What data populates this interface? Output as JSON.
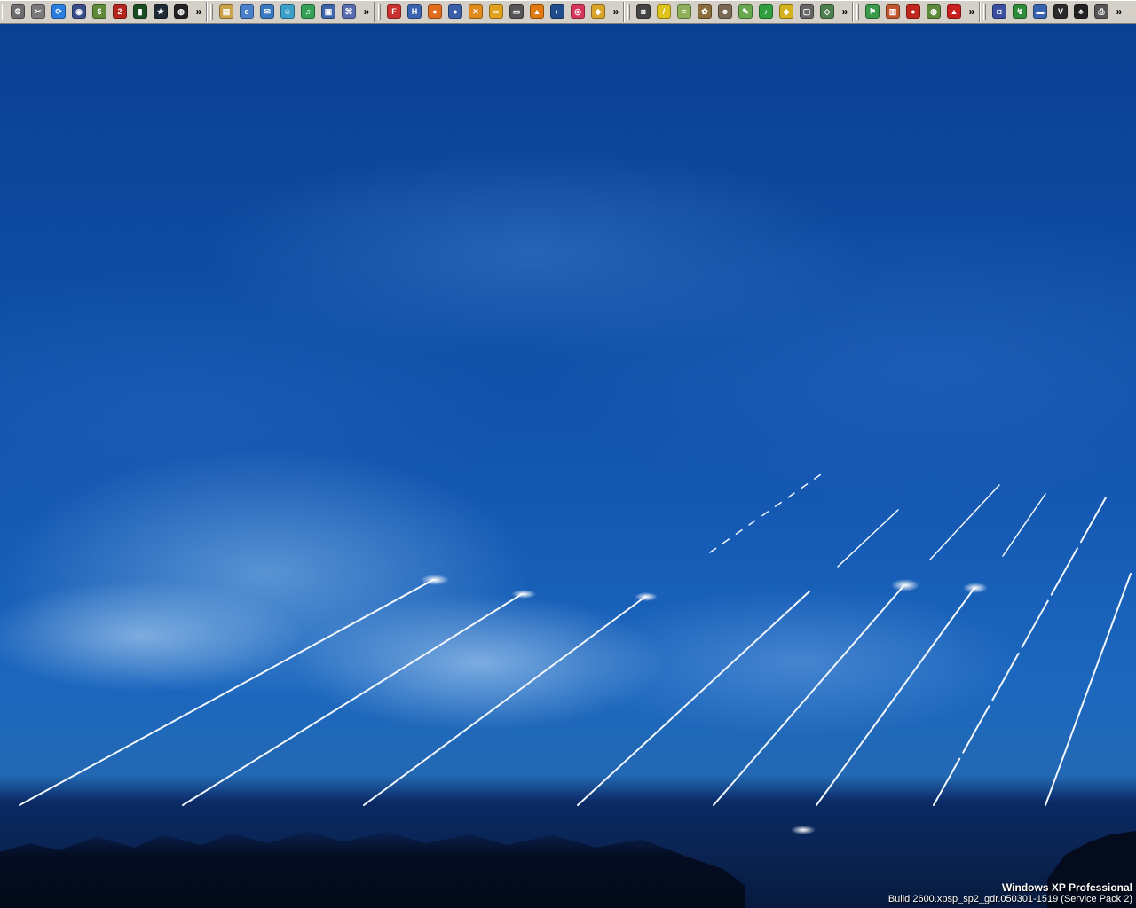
{
  "toolbar": {
    "overflow_glyph": "»",
    "groups": [
      {
        "icons": [
          {
            "name": "gear-wrench-icon",
            "glyph": "⚙",
            "color": "#6d6d6d"
          },
          {
            "name": "tools-icon",
            "glyph": "✂",
            "color": "#7a7a7a"
          },
          {
            "name": "refresh-globe-icon",
            "glyph": "⟳",
            "color": "#2b7de0"
          },
          {
            "name": "disk-manager-icon",
            "glyph": "◉",
            "color": "#3a4f8a"
          },
          {
            "name": "money-icon",
            "glyph": "$",
            "color": "#5f8a3a"
          },
          {
            "name": "two-icon",
            "glyph": "2",
            "color": "#b3261e"
          },
          {
            "name": "terminal-icon",
            "glyph": "▮",
            "color": "#1c4d22"
          },
          {
            "name": "star-app-icon",
            "glyph": "★",
            "color": "#1d2a35"
          },
          {
            "name": "steam-icon",
            "glyph": "◍",
            "color": "#222222"
          }
        ]
      },
      {
        "icons": [
          {
            "name": "folder-icon",
            "glyph": "▤",
            "color": "#c9a24a"
          },
          {
            "name": "internet-explorer-icon",
            "glyph": "e",
            "color": "#4b7fc9"
          },
          {
            "name": "outlook-icon",
            "glyph": "✉",
            "color": "#3a78c0"
          },
          {
            "name": "messenger-icon",
            "glyph": "☺",
            "color": "#3aa0c8"
          },
          {
            "name": "media-icon",
            "glyph": "♫",
            "color": "#33a055"
          },
          {
            "name": "remote-desktop-icon",
            "glyph": "▣",
            "color": "#4064a8"
          },
          {
            "name": "network-icon",
            "glyph": "⌘",
            "color": "#5a6cb0"
          }
        ]
      },
      {
        "icons": [
          {
            "name": "filezilla-icon",
            "glyph": "F",
            "color": "#c8312d"
          },
          {
            "name": "html-editor-icon",
            "glyph": "H",
            "color": "#3a64b0"
          },
          {
            "name": "firefox-icon",
            "glyph": "●",
            "color": "#e06d1c"
          },
          {
            "name": "thunderbird-icon",
            "glyph": "●",
            "color": "#3a5fa8"
          },
          {
            "name": "x-tool-icon",
            "glyph": "✕",
            "color": "#e08a1c"
          },
          {
            "name": "chat-icon",
            "glyph": "∞",
            "color": "#e0a21c"
          },
          {
            "name": "image-viewer-icon",
            "glyph": "▭",
            "color": "#555555"
          },
          {
            "name": "vlc-icon",
            "glyph": "▲",
            "color": "#e07a10"
          },
          {
            "name": "google-earth-icon",
            "glyph": "◐",
            "color": "#1f4d8c"
          },
          {
            "name": "cd-burner-icon",
            "glyph": "◎",
            "color": "#d6365a"
          },
          {
            "name": "ticket-icon",
            "glyph": "◆",
            "color": "#d9a52a"
          }
        ]
      },
      {
        "icons": [
          {
            "name": "camera-icon",
            "glyph": "◙",
            "color": "#444444"
          },
          {
            "name": "pencil-icon",
            "glyph": "/",
            "color": "#e0c21c"
          },
          {
            "name": "notes-icon",
            "glyph": "≡",
            "color": "#8fb05a"
          },
          {
            "name": "palette-icon",
            "glyph": "✿",
            "color": "#8a6c3a"
          },
          {
            "name": "gimp-icon",
            "glyph": "☻",
            "color": "#7a6a55"
          },
          {
            "name": "brush-icon",
            "glyph": "✎",
            "color": "#6aa84f"
          },
          {
            "name": "audio-icon",
            "glyph": "♪",
            "color": "#2e9e3e"
          },
          {
            "name": "media-center-icon",
            "glyph": "◈",
            "color": "#d4b21c"
          },
          {
            "name": "window-icon",
            "glyph": "▢",
            "color": "#666666"
          },
          {
            "name": "diamond-icon",
            "glyph": "◇",
            "color": "#4f7f4f"
          }
        ]
      },
      {
        "icons": [
          {
            "name": "flag-icon",
            "glyph": "⚑",
            "color": "#3a9a4a"
          },
          {
            "name": "book-icon",
            "glyph": "▥",
            "color": "#c0562e"
          },
          {
            "name": "record-icon",
            "glyph": "●",
            "color": "#c0281e"
          },
          {
            "name": "world-icon",
            "glyph": "◍",
            "color": "#5c8a3a"
          },
          {
            "name": "acrobat-icon",
            "glyph": "▲",
            "color": "#c81e1e"
          }
        ]
      },
      {
        "icons": [
          {
            "name": "virtualbox-icon",
            "glyph": "◘",
            "color": "#3a4fa0"
          },
          {
            "name": "monitor-chart-icon",
            "glyph": "↯",
            "color": "#2f8a3a"
          },
          {
            "name": "computer-icon",
            "glyph": "▬",
            "color": "#3a64b0"
          },
          {
            "name": "vr-icon",
            "glyph": "V",
            "color": "#2a2a2a"
          },
          {
            "name": "penguin-icon",
            "glyph": "♣",
            "color": "#222222"
          },
          {
            "name": "printer-icon",
            "glyph": "⎙",
            "color": "#555555"
          }
        ]
      }
    ]
  },
  "watermark": {
    "title": "Windows XP Professional",
    "build": "Build 2600.xpsp_sp2_gdr.050301-1519 (Service Pack 2)"
  }
}
